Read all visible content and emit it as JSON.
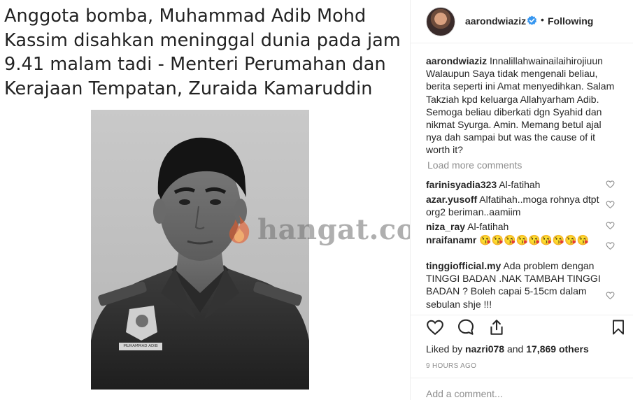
{
  "post": {
    "headline_lines": [
      "Anggota bomba, Muhammad Adib Mohd",
      "Kassim disahkan meninggal dunia pada jam",
      "9.41 malam tadi - Menteri Perumahan dan",
      "Kerajaan Tempatan, Zuraida Kamaruddin"
    ],
    "watermark": "hangat.com",
    "name_tag": "MUHAMMAD ADIB"
  },
  "header": {
    "username": "aarondwiaziz",
    "dot": "•",
    "follow_state": "Following"
  },
  "caption": {
    "username": "aarondwiaziz",
    "text": "Innalillahwainailaihirojiuun Walaupun Saya tidak mengenali beliau, berita seperti ini Amat menyedihkan. Salam Takziah kpd keluarga Allahyarham Adib. Semoga beliau diberkati dgn Syahid dan nikmat Syurga. Amin. Memang betul ajal nya dah sampai but was the cause of it worth it?"
  },
  "load_more": "Load more comments",
  "comments": [
    {
      "username": "farinisyadia323",
      "text": "Al-fatihah"
    },
    {
      "username": "azar.yusoff",
      "text": "Alfatihah..moga rohnya dtpt org2 beriman..aamiim"
    },
    {
      "username": "niza_ray",
      "text": "Al-fatihah"
    },
    {
      "username": "nraifanamr",
      "text": "😘😘😘😘😘😘😘😘😘"
    },
    {
      "username": "tinggiofficial.my",
      "text": "Ada problem dengan TINGGI BADAN .NAK TAMBAH TINGGI BADAN ? Boleh capai 5-15cm dalam sebulan shje !!!"
    }
  ],
  "likes": {
    "prefix": "Liked by",
    "user": "nazri078",
    "and": "and",
    "count": "17,869 others"
  },
  "time_ago": "9 HOURS AGO",
  "add_comment": {
    "placeholder": "Add a comment..."
  },
  "icons": {
    "like": "heart-outline-icon",
    "comment": "speech-bubble-icon",
    "share": "share-upload-icon",
    "save": "bookmark-icon",
    "verified": "verified-badge-icon"
  },
  "colors": {
    "verified": "#3897f0",
    "muted": "#8e8e8e",
    "text": "#262626"
  }
}
